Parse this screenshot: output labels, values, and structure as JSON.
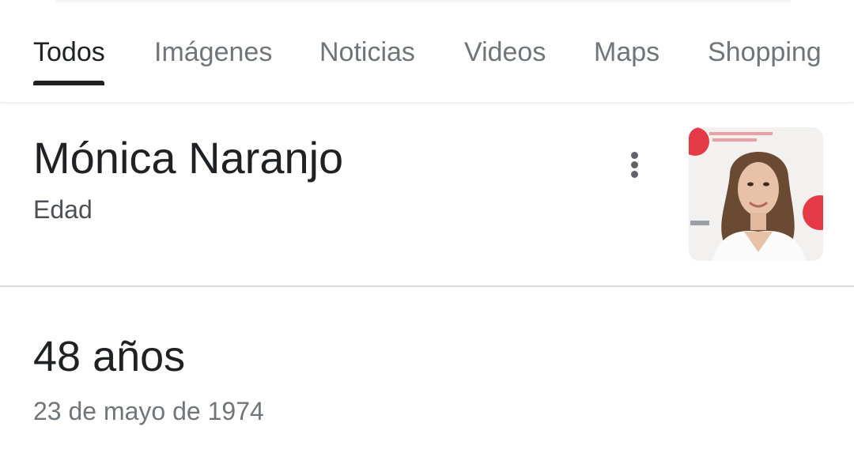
{
  "tabs": [
    {
      "label": "Todos",
      "active": true
    },
    {
      "label": "Imágenes",
      "active": false
    },
    {
      "label": "Noticias",
      "active": false
    },
    {
      "label": "Videos",
      "active": false
    },
    {
      "label": "Maps",
      "active": false
    },
    {
      "label": "Shopping",
      "active": false
    }
  ],
  "result": {
    "title": "Mónica Naranjo",
    "subtitle": "Edad",
    "menu_icon": "more-vert-icon",
    "thumbnail": "person-photo"
  },
  "answer": {
    "value": "48 años",
    "detail": "23 de mayo de 1974"
  },
  "colors": {
    "text_primary": "#202124",
    "text_secondary": "#70757a",
    "divider": "#dadce0",
    "badge_red": "#e53945"
  }
}
